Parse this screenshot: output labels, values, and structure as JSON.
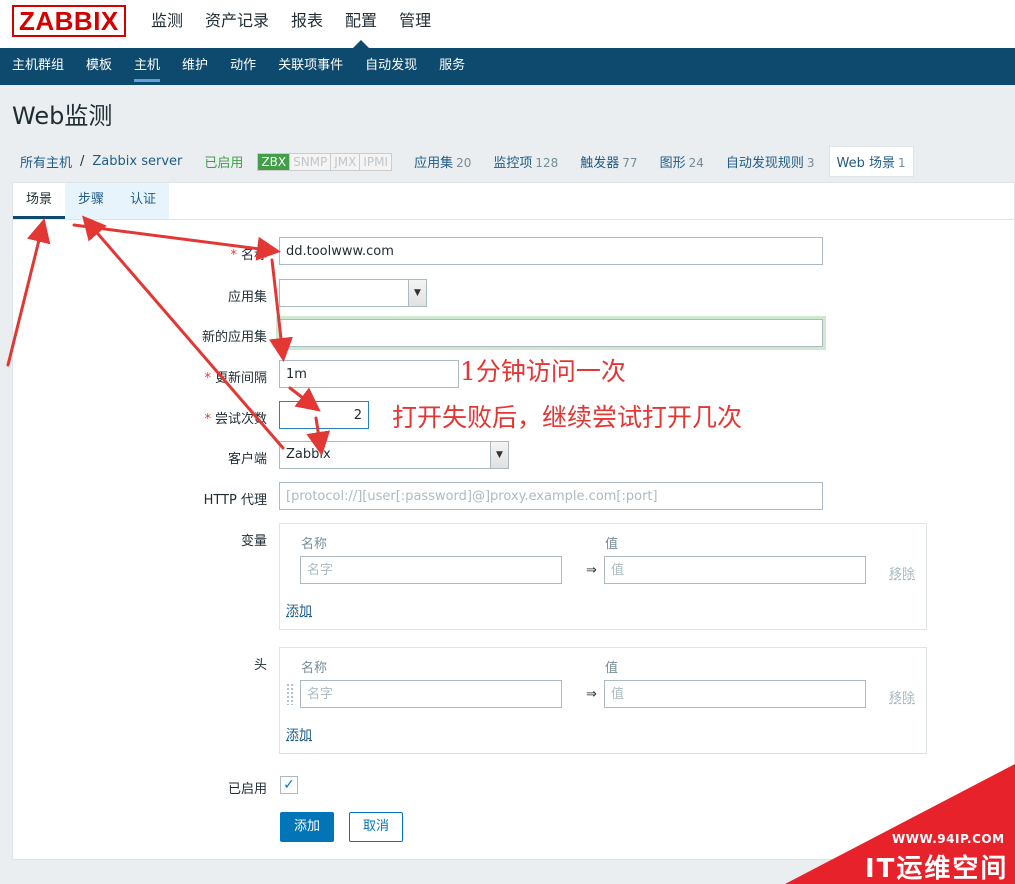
{
  "app": {
    "logo": "ZABBIX",
    "main_menu": [
      "监测",
      "资产记录",
      "报表",
      "配置",
      "管理"
    ],
    "main_menu_active": "配置",
    "sub_menu": [
      "主机群组",
      "模板",
      "主机",
      "维护",
      "动作",
      "关联项事件",
      "自动发现",
      "服务"
    ],
    "sub_menu_active": "主机"
  },
  "page": {
    "title": "Web监测"
  },
  "host_nav": {
    "all_hosts": "所有主机",
    "separator": "/",
    "host": "Zabbix server",
    "status": "已启用",
    "availability": [
      {
        "label": "ZBX",
        "active": true
      },
      {
        "label": "SNMP",
        "active": false
      },
      {
        "label": "JMX",
        "active": false
      },
      {
        "label": "IPMI",
        "active": false
      }
    ],
    "links": [
      {
        "label": "应用集",
        "count": "20"
      },
      {
        "label": "监控项",
        "count": "128"
      },
      {
        "label": "触发器",
        "count": "77"
      },
      {
        "label": "图形",
        "count": "24"
      },
      {
        "label": "自动发现规则",
        "count": "3"
      },
      {
        "label": "Web 场景",
        "count": "1"
      }
    ]
  },
  "tabs": [
    "场景",
    "步骤",
    "认证"
  ],
  "form": {
    "name": {
      "label": "名称",
      "value": "dd.toolwww.com"
    },
    "application": {
      "label": "应用集",
      "value": ""
    },
    "new_application": {
      "label": "新的应用集",
      "value": ""
    },
    "update_interval": {
      "label": "更新间隔",
      "value": "1m"
    },
    "attempts": {
      "label": "尝试次数",
      "value": "2"
    },
    "agent": {
      "label": "客户端",
      "value": "Zabbix"
    },
    "http_proxy": {
      "label": "HTTP 代理",
      "placeholder": "[protocol://][user[:password]@]proxy.example.com[:port]"
    },
    "variables": {
      "label": "变量",
      "col_name": "名称",
      "col_value": "值",
      "name_placeholder": "名字",
      "value_placeholder": "值",
      "arrow": "⇒",
      "remove": "移除",
      "add": "添加"
    },
    "headers": {
      "label": "头",
      "col_name": "名称",
      "col_value": "值",
      "name_placeholder": "名字",
      "value_placeholder": "值",
      "arrow": "⇒",
      "remove": "移除",
      "add": "添加"
    },
    "enabled": {
      "label": "已启用",
      "checked": true
    },
    "buttons": {
      "add": "添加",
      "cancel": "取消"
    }
  },
  "annotations": {
    "interval_note": "1分钟访问一次",
    "attempts_note": "打开失败后，继续尝试打开几次"
  },
  "watermark": {
    "url": "WWW.94IP.COM",
    "name": "IT运维空间"
  },
  "colors": {
    "brand": "#d40000",
    "nav_bg": "#0e4a6e",
    "link": "#1f5c87",
    "enabled_green": "#429e47",
    "primary_button": "#0275b8",
    "annotation_red": "#e33734"
  }
}
